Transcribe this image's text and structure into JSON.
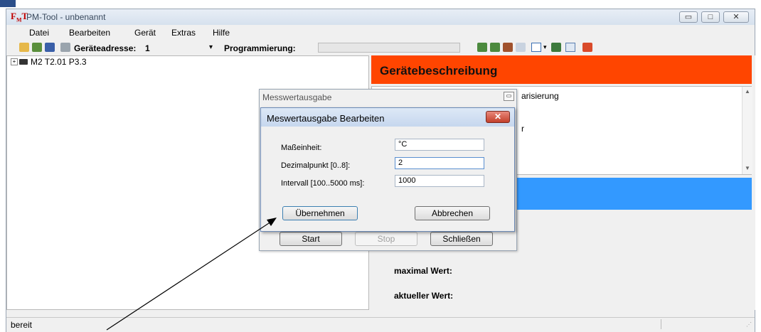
{
  "app": {
    "title": "PM-Tool - unbenannt",
    "icon": "pm-logo-icon"
  },
  "window_controls": {
    "minimize": "▭",
    "maximize": "□",
    "close": "✕"
  },
  "menu": {
    "items": [
      "Datei",
      "Bearbeiten",
      "Gerät",
      "Extras",
      "Hilfe"
    ]
  },
  "toolbar": {
    "address_label": "Geräteadresse:",
    "address_value": "1",
    "programming_label": "Programmierung:"
  },
  "tree": {
    "root_label": "M2 T2.01 P3.3"
  },
  "device_panel": {
    "header": "Gerätebeschreibung",
    "desc_fragment_1": "arisierung",
    "desc_fragment_2": "r",
    "max_label": "maximal Wert:",
    "current_label": "aktueller Wert:"
  },
  "outer_dialog": {
    "title": "Messwertausgabe",
    "start": "Start",
    "stop": "Stop",
    "close": "Schließen"
  },
  "inner_dialog": {
    "title": "Meswertausgabe Bearbeiten",
    "unit_label": "Maßeinheit:",
    "unit_value": "°C",
    "decimal_label": "Dezimalpunkt [0..8]:",
    "decimal_value": "2",
    "interval_label": "Intervall [100..5000 ms]:",
    "interval_value": "1000",
    "apply": "Übernehmen",
    "cancel": "Abbrechen"
  },
  "status": {
    "text": "bereit"
  },
  "colors": {
    "orange_header": "#ff4500",
    "blue_bar": "#3399ff"
  }
}
